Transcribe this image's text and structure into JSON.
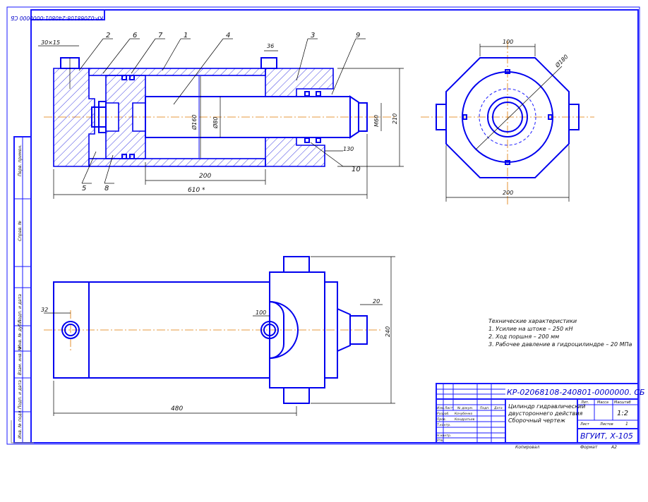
{
  "stamp_top": "КР-02068108-240801-0000000 СБ",
  "section_view": {
    "callouts": [
      "2",
      "6",
      "7",
      "1",
      "4",
      "36",
      "3",
      "9",
      "5",
      "8",
      "10"
    ],
    "dims": {
      "chamfer": "30×15",
      "port_width": "36",
      "piston_dia": "Ø160",
      "rod_dia": "Ø80",
      "rod_end_dia": "М60",
      "height": "210",
      "gland": "130",
      "stroke": "200",
      "length": "610 *"
    }
  },
  "end_view": {
    "dims": {
      "top": "100",
      "diag": "Ø180",
      "bottom": "200"
    }
  },
  "side_view": {
    "dims": {
      "left_hole": "32",
      "mount": "100",
      "rod": "20",
      "height": "240",
      "length": "480"
    }
  },
  "tech_notes": {
    "title": "Технические характеристики",
    "lines": [
      "1. Усилие на штоке – 250 кН",
      "2. Ход поршня – 200 мм",
      "3. Рабочее давление в гидроцилиндре – 20 МПа"
    ]
  },
  "left_strip": [
    "Инв. № подл.",
    "Подп. и дата",
    "Взам. инв. №",
    "Инв. № дубл.",
    "Подп. и дата",
    "Справ. №",
    "Перв. примен."
  ],
  "title_block": {
    "designation": "КР-02068108-240801-0000000. СБ",
    "name_lines": [
      "Цилиндр гидравлический",
      "двустороннего действия",
      "Сборочный чертеж"
    ],
    "row_labels": [
      "Изм.",
      "Лист",
      "№ докум.",
      "Подп.",
      "Дата"
    ],
    "roles": [
      "Разраб.",
      "Пров.",
      "Т.контр.",
      "Н.контр.",
      "Утв."
    ],
    "role_names": [
      "Кочубенко",
      "Кондратьев"
    ],
    "col_heads": [
      "Лит.",
      "Масса",
      "Масштаб"
    ],
    "scale": "1:2",
    "sheet_label": "Лист",
    "sheets_label": "Листов",
    "sheets_count": "1",
    "org": "ВГУИТ, Х-105",
    "copied": "Копировал",
    "format_label": "Формат",
    "format": "А2"
  }
}
